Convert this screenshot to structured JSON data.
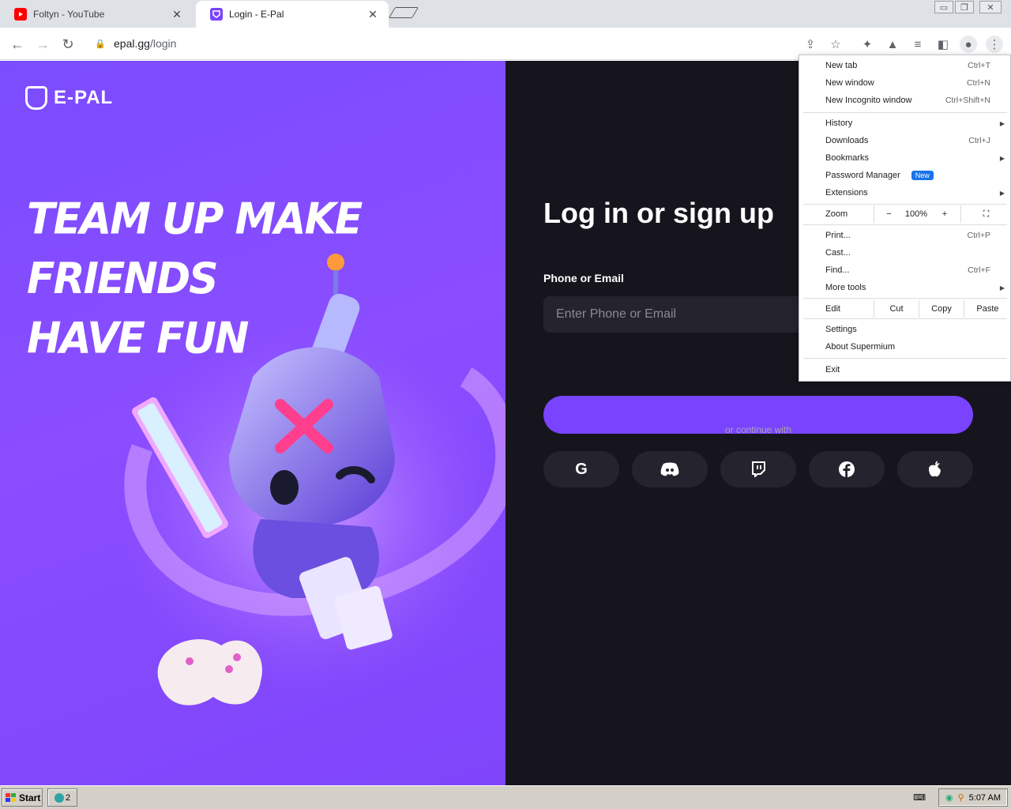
{
  "tabs": [
    {
      "title": "Foltyn - YouTube",
      "favicon": "youtube-icon"
    },
    {
      "title": "Login - E-Pal",
      "favicon": "epal-icon",
      "active": true
    }
  ],
  "window_controls": {
    "minimize": "▭",
    "restore": "❐",
    "close": "✕"
  },
  "address_bar": {
    "domain": "epal.gg",
    "path": "/login"
  },
  "page": {
    "logo_text": "E-PAL",
    "hero_line1": "TEAM UP MAKE FRIENDS",
    "hero_line2": "HAVE FUN",
    "form_title": "Log in or sign up",
    "field_label": "Phone or Email",
    "field_placeholder": "Enter Phone or Email",
    "continue_with": "or continue with",
    "social_buttons": [
      "G",
      "D",
      "T",
      "f",
      ""
    ]
  },
  "menu": {
    "new_tab": "New tab",
    "new_tab_sc": "Ctrl+T",
    "new_window": "New window",
    "new_window_sc": "Ctrl+N",
    "incognito": "New Incognito window",
    "incognito_sc": "Ctrl+Shift+N",
    "history": "History",
    "downloads": "Downloads",
    "downloads_sc": "Ctrl+J",
    "bookmarks": "Bookmarks",
    "password_manager": "Password Manager",
    "new_badge": "New",
    "extensions": "Extensions",
    "zoom": "Zoom",
    "zoom_minus": "−",
    "zoom_level": "100%",
    "zoom_plus": "+",
    "print": "Print...",
    "print_sc": "Ctrl+P",
    "cast": "Cast...",
    "find": "Find...",
    "find_sc": "Ctrl+F",
    "more_tools": "More tools",
    "edit": "Edit",
    "cut": "Cut",
    "copy": "Copy",
    "paste": "Paste",
    "settings": "Settings",
    "about": "About Supermium",
    "exit": "Exit"
  },
  "taskbar": {
    "start": "Start",
    "task_count": "2",
    "clock": "5:07 AM"
  },
  "colors": {
    "brand_purple": "#7a43ff",
    "dark_bg": "#16151d",
    "badge_blue": "#1a73e8"
  }
}
